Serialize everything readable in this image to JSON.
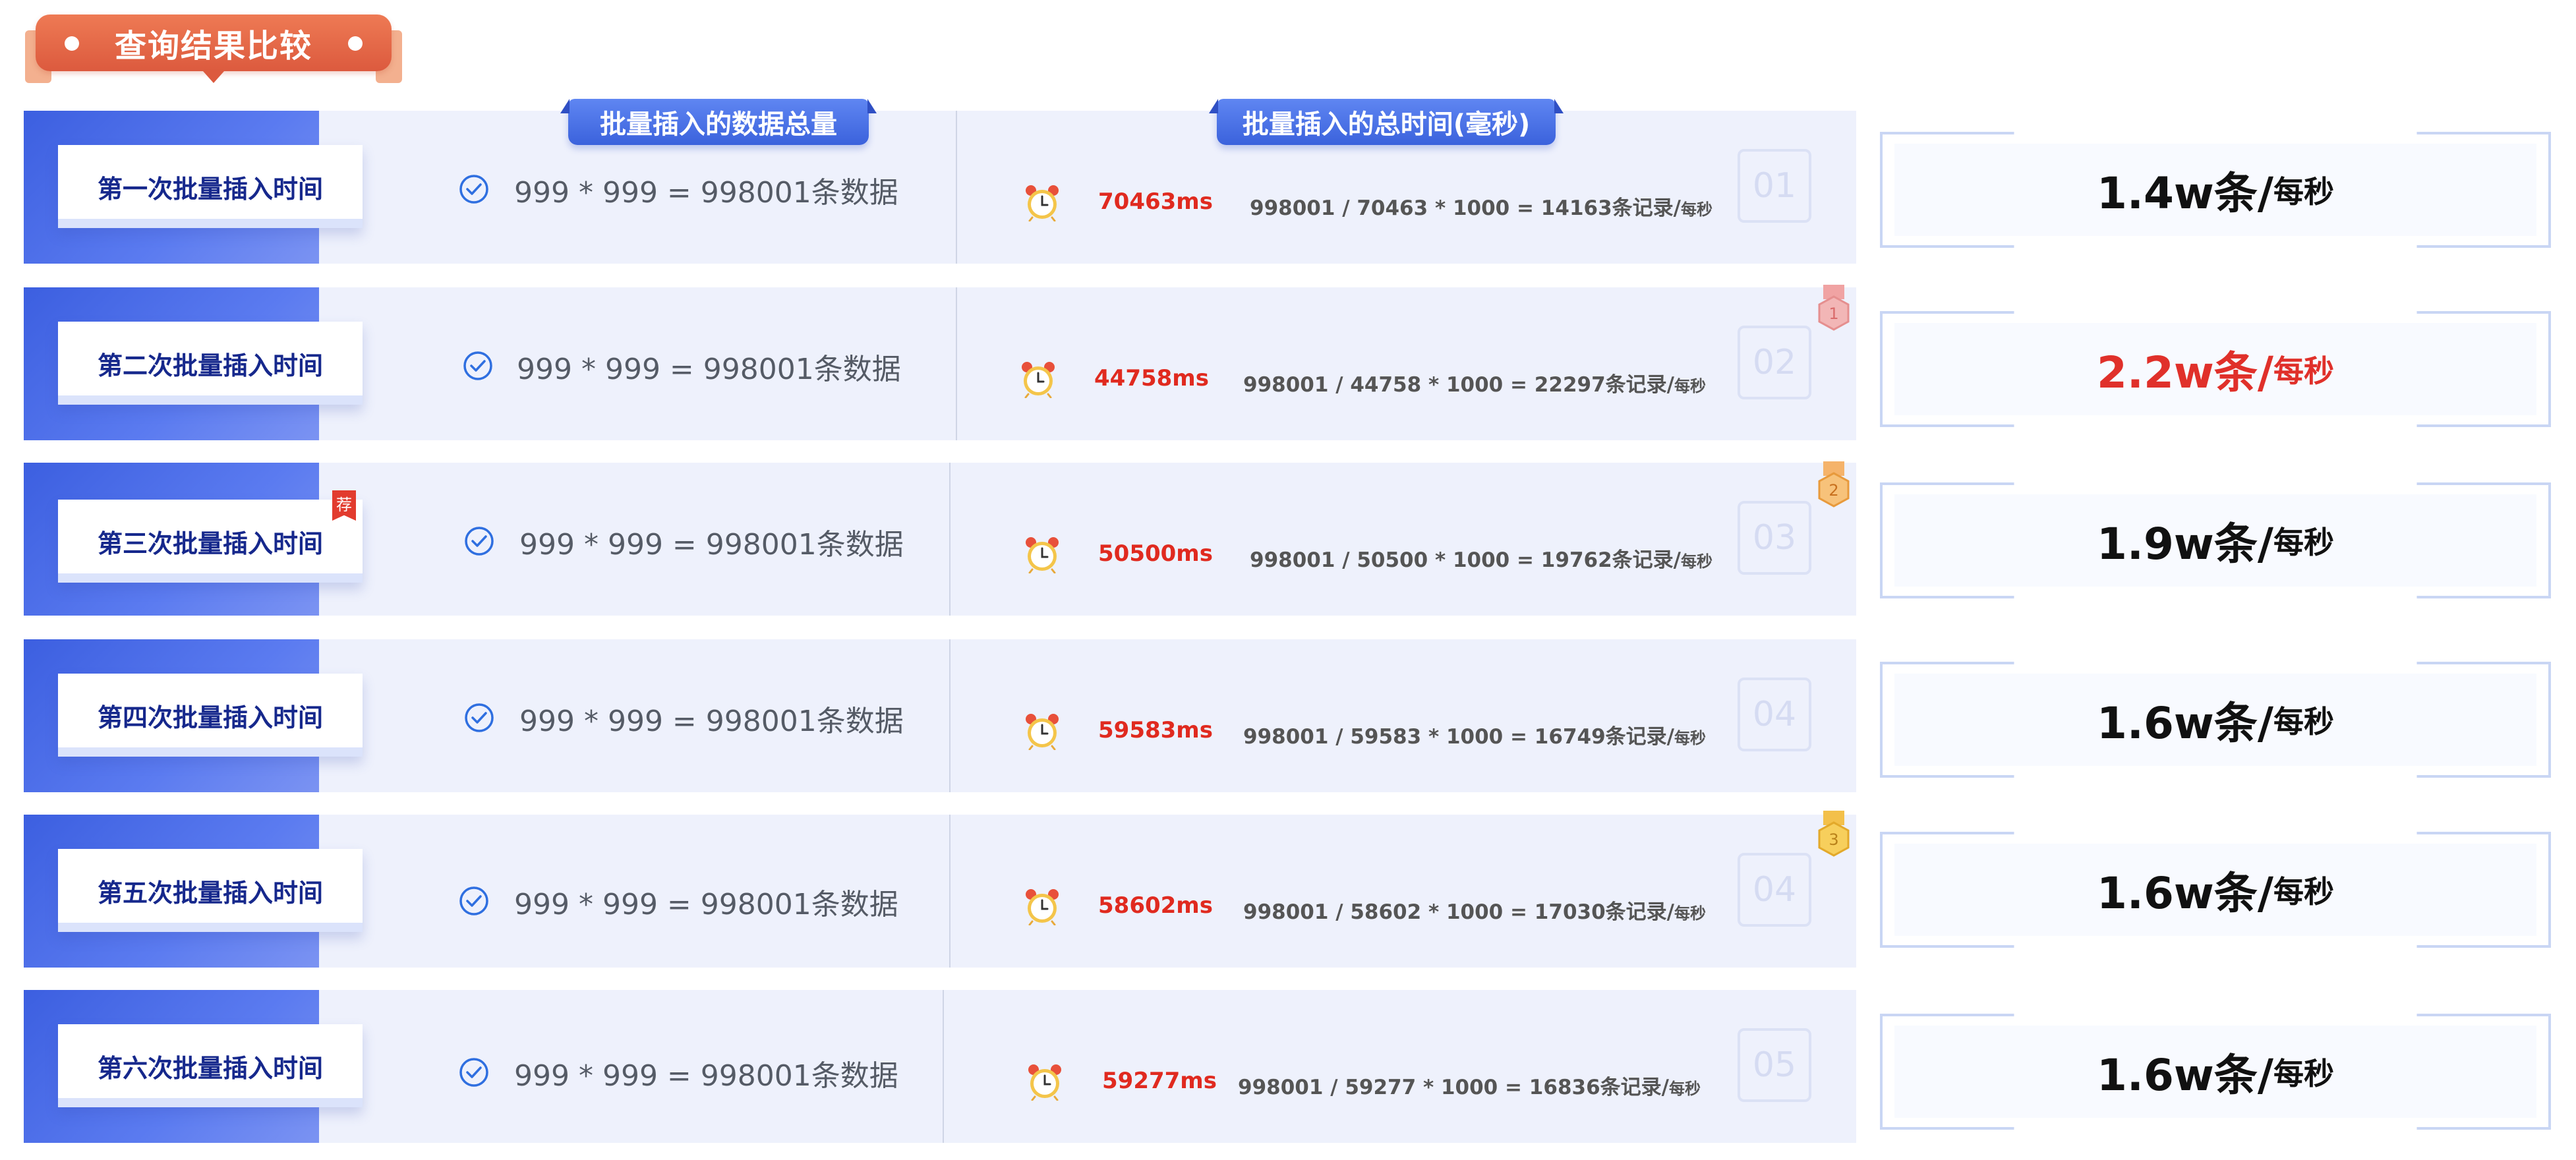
{
  "title": "查询结果比较",
  "headers": {
    "total_data": "批量插入的数据总量",
    "total_time": "批量插入的总时间(毫秒)"
  },
  "colors": {
    "accent_blue": "#3c5fe0",
    "title_orange": "#e06a48",
    "ms_red": "#e02a1f",
    "best_red": "#e0302a"
  },
  "rows": [
    {
      "label": "第一次批量插入时间",
      "formula1": "999 * 999 = 998001条数据",
      "ms": "70463ms",
      "formula2": "998001 / 70463 * 1000 = 14163条记录/",
      "per_unit": "每秒",
      "number": "01",
      "result_value": "1.4w条/",
      "result_per": "每秒",
      "best": false
    },
    {
      "label": "第二次批量插入时间",
      "formula1": "999 * 999 = 998001条数据",
      "ms": "44758ms",
      "formula2": "998001 / 44758 * 1000 = 22297条记录/",
      "per_unit": "每秒",
      "number": "02",
      "medal": "1",
      "result_value": "2.2w条/",
      "result_per": "每秒",
      "best": true
    },
    {
      "label": "第三次批量插入时间",
      "badge": "荐",
      "formula1": "999 * 999 = 998001条数据",
      "ms": "50500ms",
      "formula2": "998001 / 50500 * 1000 = 19762条记录/",
      "per_unit": "每秒",
      "number": "03",
      "medal": "2",
      "result_value": "1.9w条/",
      "result_per": "每秒",
      "best": false
    },
    {
      "label": "第四次批量插入时间",
      "formula1": "999 * 999 = 998001条数据",
      "ms": "59583ms",
      "formula2": "998001 / 59583 * 1000 = 16749条记录/",
      "per_unit": "每秒",
      "number": "04",
      "result_value": "1.6w条/",
      "result_per": "每秒",
      "best": false
    },
    {
      "label": "第五次批量插入时间",
      "formula1": "999 * 999 = 998001条数据",
      "ms": "58602ms",
      "formula2": "998001 / 58602 * 1000 = 17030条记录/",
      "per_unit": "每秒",
      "number": "04",
      "medal": "3",
      "result_value": "1.6w条/",
      "result_per": "每秒",
      "best": false
    },
    {
      "label": "第六次批量插入时间",
      "formula1": "999 * 999 = 998001条数据",
      "ms": "59277ms",
      "formula2": "998001 / 59277 * 1000 = 16836条记录/",
      "per_unit": "每秒",
      "number": "05",
      "result_value": "1.6w条/",
      "result_per": "每秒",
      "best": false
    }
  ]
}
